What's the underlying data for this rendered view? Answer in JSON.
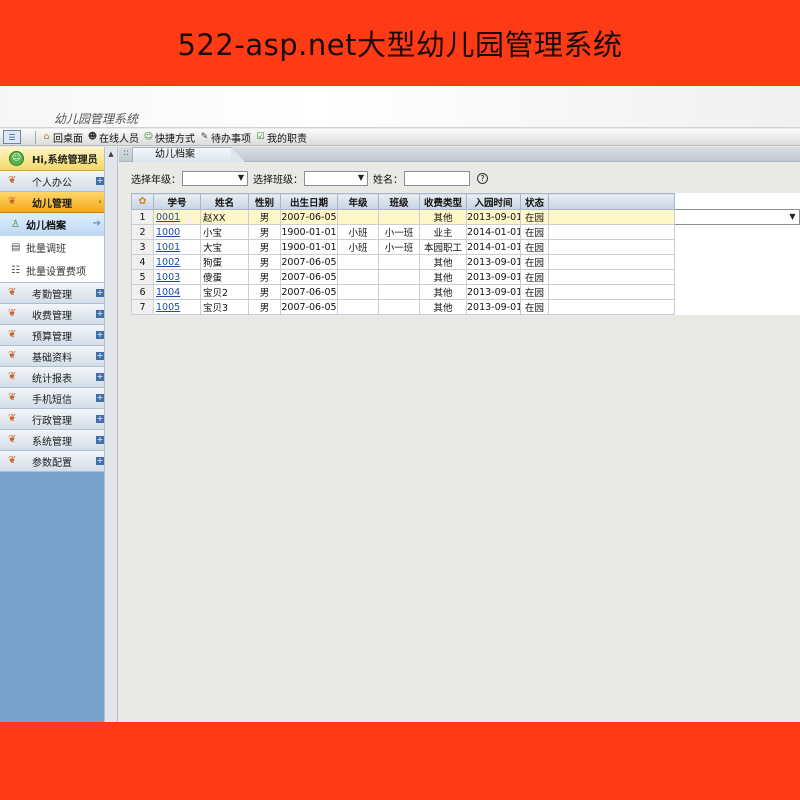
{
  "banner": {
    "title": "522-asp.net大型幼儿园管理系统"
  },
  "header": {
    "app_title": "幼儿园管理系统"
  },
  "toolbar": {
    "items": [
      "回桌面",
      "在线人员",
      "快捷方式",
      "待办事项",
      "我的职责"
    ]
  },
  "sidebar": {
    "user": "Hi,系统管理员",
    "menu": [
      {
        "label": "个人办公"
      },
      {
        "label": "幼儿管理"
      }
    ],
    "sub_items": [
      "幼儿档案",
      "批量调班",
      "批量设置费项"
    ],
    "menu_rest": [
      "考勤管理",
      "收费管理",
      "预算管理",
      "基础资料",
      "统计报表",
      "手机短信",
      "行政管理",
      "系统管理",
      "参数配置"
    ]
  },
  "tab": {
    "label": "幼儿档案"
  },
  "filters": {
    "grade_label": "选择年级：",
    "class_label": "选择班级：",
    "name_label": "姓名：",
    "help": "?"
  },
  "table": {
    "headers": [
      "学号",
      "姓名",
      "性别",
      "出生日期",
      "年级",
      "班级",
      "收费类型",
      "入园时间",
      "状态"
    ],
    "rows": [
      {
        "n": "1",
        "id": "0001",
        "name": "赵XX",
        "sex": "男",
        "birth": "2007-06-05",
        "grade": "",
        "class": "",
        "fee": "其他",
        "enter": "2013-09-01",
        "status": "在园"
      },
      {
        "n": "2",
        "id": "1000",
        "name": "小宝",
        "sex": "男",
        "birth": "1900-01-01",
        "grade": "小班",
        "class": "小一班",
        "fee": "业主",
        "enter": "2014-01-01",
        "status": "在园"
      },
      {
        "n": "3",
        "id": "1001",
        "name": "大宝",
        "sex": "男",
        "birth": "1900-01-01",
        "grade": "小班",
        "class": "小一班",
        "fee": "本园职工",
        "enter": "2014-01-01",
        "status": "在园"
      },
      {
        "n": "4",
        "id": "1002",
        "name": "狗蛋",
        "sex": "男",
        "birth": "2007-06-05",
        "grade": "",
        "class": "",
        "fee": "其他",
        "enter": "2013-09-01",
        "status": "在园"
      },
      {
        "n": "5",
        "id": "1003",
        "name": "傻蛋",
        "sex": "男",
        "birth": "2007-06-05",
        "grade": "",
        "class": "",
        "fee": "其他",
        "enter": "2013-09-01",
        "status": "在园"
      },
      {
        "n": "6",
        "id": "1004",
        "name": "宝贝2",
        "sex": "男",
        "birth": "2007-06-05",
        "grade": "",
        "class": "",
        "fee": "其他",
        "enter": "2013-09-01",
        "status": "在园"
      },
      {
        "n": "7",
        "id": "1005",
        "name": "宝贝3",
        "sex": "男",
        "birth": "2007-06-05",
        "grade": "",
        "class": "",
        "fee": "其他",
        "enter": "2013-09-01",
        "status": "在园"
      }
    ]
  },
  "colors": {
    "banner": "#ff3b16",
    "sidebar": "#7aa3cb",
    "active_menu": "#f4a91a",
    "selected_row": "#fff7c7",
    "link": "#1f49a8"
  }
}
